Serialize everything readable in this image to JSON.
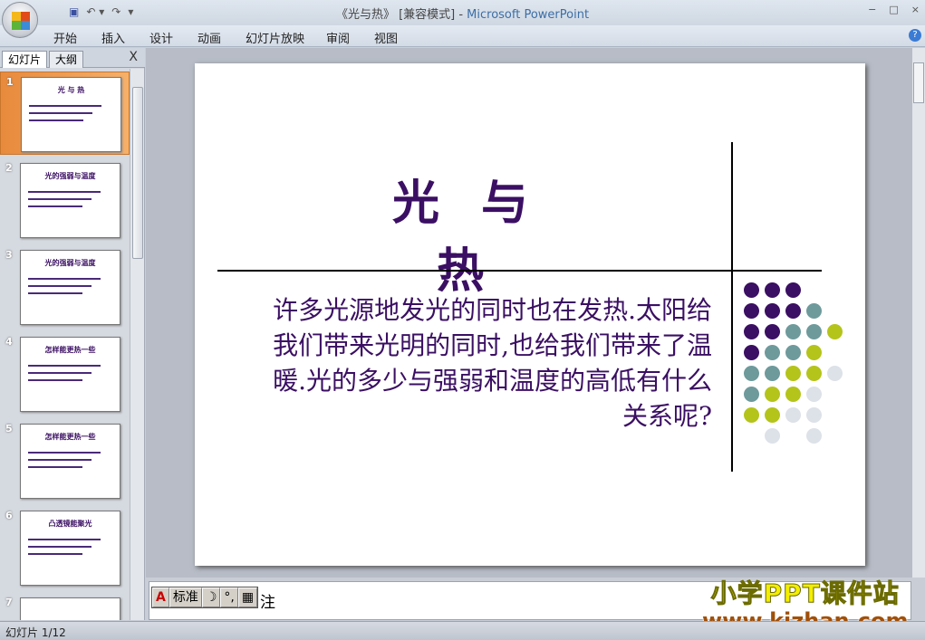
{
  "window": {
    "title_doc": "《光与热》 [兼容模式] - ",
    "title_app": "Microsoft PowerPoint",
    "controls": [
      "−",
      "□",
      "×"
    ]
  },
  "ribbon_tabs": [
    "开始",
    "插入",
    "设计",
    "动画",
    "幻灯片放映",
    "审阅",
    "视图"
  ],
  "panel": {
    "tabs": [
      "幻灯片",
      "大纲"
    ],
    "close": "X",
    "slides": [
      {
        "num": "1",
        "title": "光 与 热"
      },
      {
        "num": "2",
        "title": "光的强弱与温度"
      },
      {
        "num": "3",
        "title": "光的强弱与温度"
      },
      {
        "num": "4",
        "title": "怎样能更热一些"
      },
      {
        "num": "5",
        "title": "怎样能更热一些"
      },
      {
        "num": "6",
        "title": "凸透镜能聚光"
      },
      {
        "num": "7",
        "title": ""
      }
    ]
  },
  "slide": {
    "title": "光 与 热",
    "body": "许多光源地发光的同时也在发热.太阳给我们带来光明的同时,也给我们带来了温暖.光的多少与强弱和温度的高低有什么关系呢?",
    "dot_colors": {
      "P": "#3b0f63",
      "T": "#6e9a9c",
      "L": "#b4c41a",
      "G": "#dde1e8"
    },
    "dot_pattern": [
      "PPP  ",
      "PPPT ",
      "PPTTL",
      "PTTL ",
      "TTLLG",
      "TLLG ",
      "LLGG ",
      " G G "
    ]
  },
  "notes": {
    "text": "注",
    "ime": [
      "标准",
      "☽",
      "°,",
      "▦"
    ]
  },
  "watermark": {
    "line1": "小学PPT课件站",
    "line2": "www.kjzhan.com"
  },
  "status": {
    "slide_count": "幻灯片 1/12"
  }
}
